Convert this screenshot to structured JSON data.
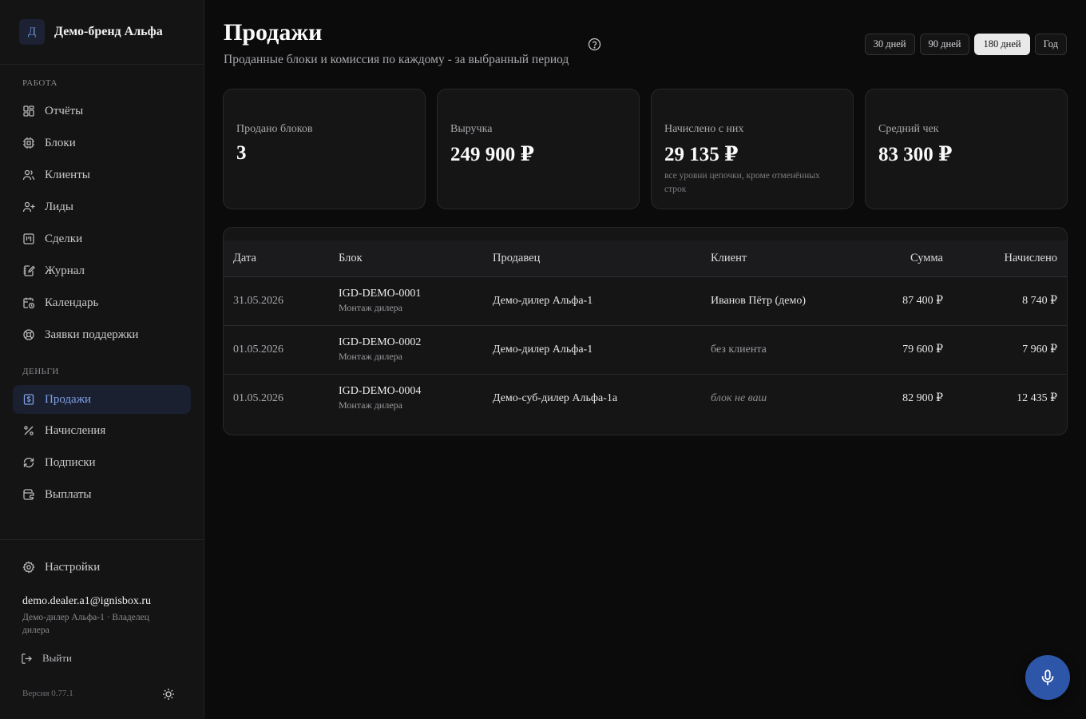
{
  "brand": {
    "logo_letter": "Д",
    "name": "Демо-бренд Альфа"
  },
  "sidebar": {
    "sections": [
      {
        "label": "Работа"
      },
      {
        "label": "Деньги"
      }
    ],
    "items": [
      {
        "label": "Отчёты",
        "icon": "dashboard-icon"
      },
      {
        "label": "Блоки",
        "icon": "chip-icon"
      },
      {
        "label": "Клиенты",
        "icon": "users-icon"
      },
      {
        "label": "Лиды",
        "icon": "user-plus-icon"
      },
      {
        "label": "Сделки",
        "icon": "kanban-icon"
      },
      {
        "label": "Журнал",
        "icon": "notebook-pen-icon"
      },
      {
        "label": "Календарь",
        "icon": "calendar-clock-icon"
      },
      {
        "label": "Заявки поддержки",
        "icon": "life-buoy-icon"
      },
      {
        "label": "Продажи",
        "icon": "receipt-dollar-icon",
        "active": true
      },
      {
        "label": "Начисления",
        "icon": "percent-icon"
      },
      {
        "label": "Подписки",
        "icon": "refresh-icon"
      },
      {
        "label": "Выплаты",
        "icon": "wallet-icon"
      }
    ],
    "settings_label": "Настройки",
    "user": {
      "email": "demo.dealer.a1@ignisbox.ru",
      "role": "Демо-дилер Альфа-1 · Владелец дилера"
    },
    "logout_label": "Выйти",
    "version": "Версия 0.77.1"
  },
  "header": {
    "title": "Продажи",
    "subtitle": "Проданные блоки и комиссия по каждому - за выбранный период",
    "periods": [
      {
        "label": "30 дней",
        "active": false
      },
      {
        "label": "90 дней",
        "active": false
      },
      {
        "label": "180 дней",
        "active": true
      },
      {
        "label": "Год",
        "active": false
      }
    ]
  },
  "stats": [
    {
      "label": "Продано блоков",
      "value": "3",
      "note": ""
    },
    {
      "label": "Выручка",
      "value": "249 900 ₽",
      "note": ""
    },
    {
      "label": "Начислено с них",
      "value": "29 135 ₽",
      "note": "все уровни цепочки, кроме отменённых строк"
    },
    {
      "label": "Средний чек",
      "value": "83 300 ₽",
      "note": ""
    }
  ],
  "table": {
    "columns": [
      "Дата",
      "Блок",
      "Продавец",
      "Клиент",
      "Сумма",
      "Начислено"
    ],
    "rows": [
      {
        "date": "31.05.2026",
        "block": "IGD-DEMO-0001",
        "block_sub": "Монтаж дилера",
        "seller": "Демо-дилер Альфа-1",
        "client": "Иванов Пётр (демо)",
        "client_style": "normal",
        "amount": "87 400 ₽",
        "accrued": "8 740 ₽"
      },
      {
        "date": "01.05.2026",
        "block": "IGD-DEMO-0002",
        "block_sub": "Монтаж дилера",
        "seller": "Демо-дилер Альфа-1",
        "client": "без клиента",
        "client_style": "muted",
        "amount": "79 600 ₽",
        "accrued": "7 960 ₽"
      },
      {
        "date": "01.05.2026",
        "block": "IGD-DEMO-0004",
        "block_sub": "Монтаж дилера",
        "seller": "Демо-суб-дилер Альфа-1а",
        "client": "блок не ваш",
        "client_style": "italic",
        "amount": "82 900 ₽",
        "accrued": "12 435 ₽"
      }
    ]
  },
  "colors": {
    "accent": "#2d55a8",
    "active_nav_text": "#7fa0e6",
    "background": "#0b0b0c"
  }
}
